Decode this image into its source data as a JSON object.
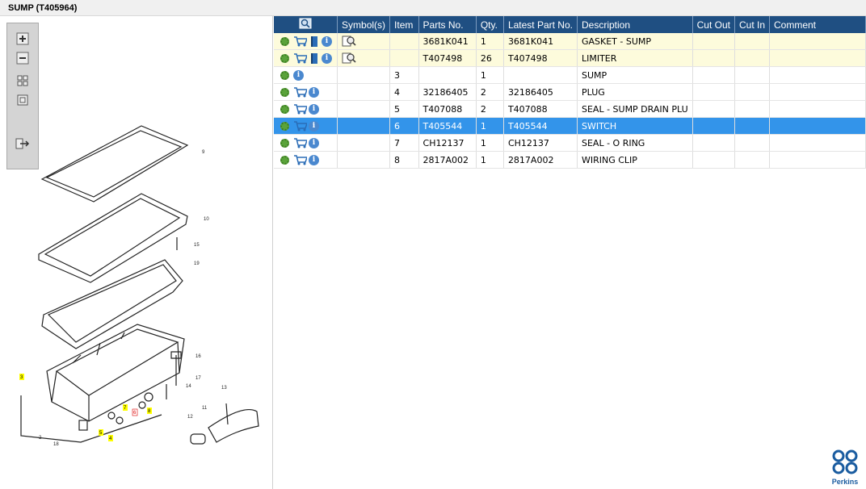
{
  "window_title": "SUMP (T405964)",
  "toolbar": {
    "buttons": [
      {
        "name": "zoom-in-icon"
      },
      {
        "name": "zoom-out-icon"
      },
      {
        "name": "fit-all-icon"
      },
      {
        "name": "actual-size-icon"
      },
      {
        "name": "export-icon"
      }
    ]
  },
  "diagram": {
    "callouts": [
      "9",
      "10",
      "15",
      "19",
      "16",
      "17",
      "14",
      "13",
      "11",
      "12",
      "2",
      "18",
      "3",
      "7",
      "8",
      "5",
      "4"
    ],
    "highlighted_callouts": [
      "3",
      "7",
      "8",
      "5",
      "4"
    ],
    "selected_callout": "6"
  },
  "table": {
    "headers": [
      "",
      "Symbol(s)",
      "Item",
      "Parts No.",
      "Qty.",
      "Latest Part No.",
      "Description",
      "Cut Out",
      "Cut In",
      "Comment"
    ],
    "rows": [
      {
        "item": "",
        "part": "3681K041",
        "qty": "1",
        "latest": "3681K041",
        "desc": "GASKET - SUMP",
        "cut_out": "",
        "cut_in": "",
        "comment": "",
        "variant": "yellow",
        "actions": [
          "gear",
          "cart",
          "book",
          "info"
        ],
        "symbol": "magnifier"
      },
      {
        "item": "",
        "part": "T407498",
        "qty": "26",
        "latest": "T407498",
        "desc": "LIMITER",
        "cut_out": "",
        "cut_in": "",
        "comment": "",
        "variant": "yellow",
        "actions": [
          "gear",
          "cart",
          "book",
          "info"
        ],
        "symbol": "magnifier"
      },
      {
        "item": "3",
        "part": "",
        "qty": "1",
        "latest": "",
        "desc": "SUMP",
        "cut_out": "",
        "cut_in": "",
        "comment": "",
        "variant": "",
        "actions": [
          "gear",
          "info"
        ],
        "symbol": ""
      },
      {
        "item": "4",
        "part": "32186405",
        "qty": "2",
        "latest": "32186405",
        "desc": "PLUG",
        "cut_out": "",
        "cut_in": "",
        "comment": "",
        "variant": "",
        "actions": [
          "gear",
          "cart",
          "info"
        ],
        "symbol": ""
      },
      {
        "item": "5",
        "part": "T407088",
        "qty": "2",
        "latest": "T407088",
        "desc": "SEAL - SUMP DRAIN PLU",
        "cut_out": "",
        "cut_in": "",
        "comment": "",
        "variant": "",
        "actions": [
          "gear",
          "cart",
          "info"
        ],
        "symbol": ""
      },
      {
        "item": "6",
        "part": "T405544",
        "qty": "1",
        "latest": "T405544",
        "desc": "SWITCH",
        "cut_out": "",
        "cut_in": "",
        "comment": "",
        "variant": "sel",
        "actions": [
          "gear",
          "cart",
          "info"
        ],
        "symbol": ""
      },
      {
        "item": "7",
        "part": "CH12137",
        "qty": "1",
        "latest": "CH12137",
        "desc": "SEAL - O RING",
        "cut_out": "",
        "cut_in": "",
        "comment": "",
        "variant": "",
        "actions": [
          "gear",
          "cart",
          "info"
        ],
        "symbol": ""
      },
      {
        "item": "8",
        "part": "2817A002",
        "qty": "1",
        "latest": "2817A002",
        "desc": "WIRING CLIP",
        "cut_out": "",
        "cut_in": "",
        "comment": "",
        "variant": "",
        "actions": [
          "gear",
          "cart",
          "info"
        ],
        "symbol": ""
      }
    ]
  },
  "brand": {
    "name": "Perkins",
    "color": "#1a5ca0"
  },
  "colors": {
    "header_bg": "#1f4f82",
    "selected_row": "#3394ea",
    "highlight_row": "#fdfbdc",
    "callout_highlight": "#ffff00"
  }
}
